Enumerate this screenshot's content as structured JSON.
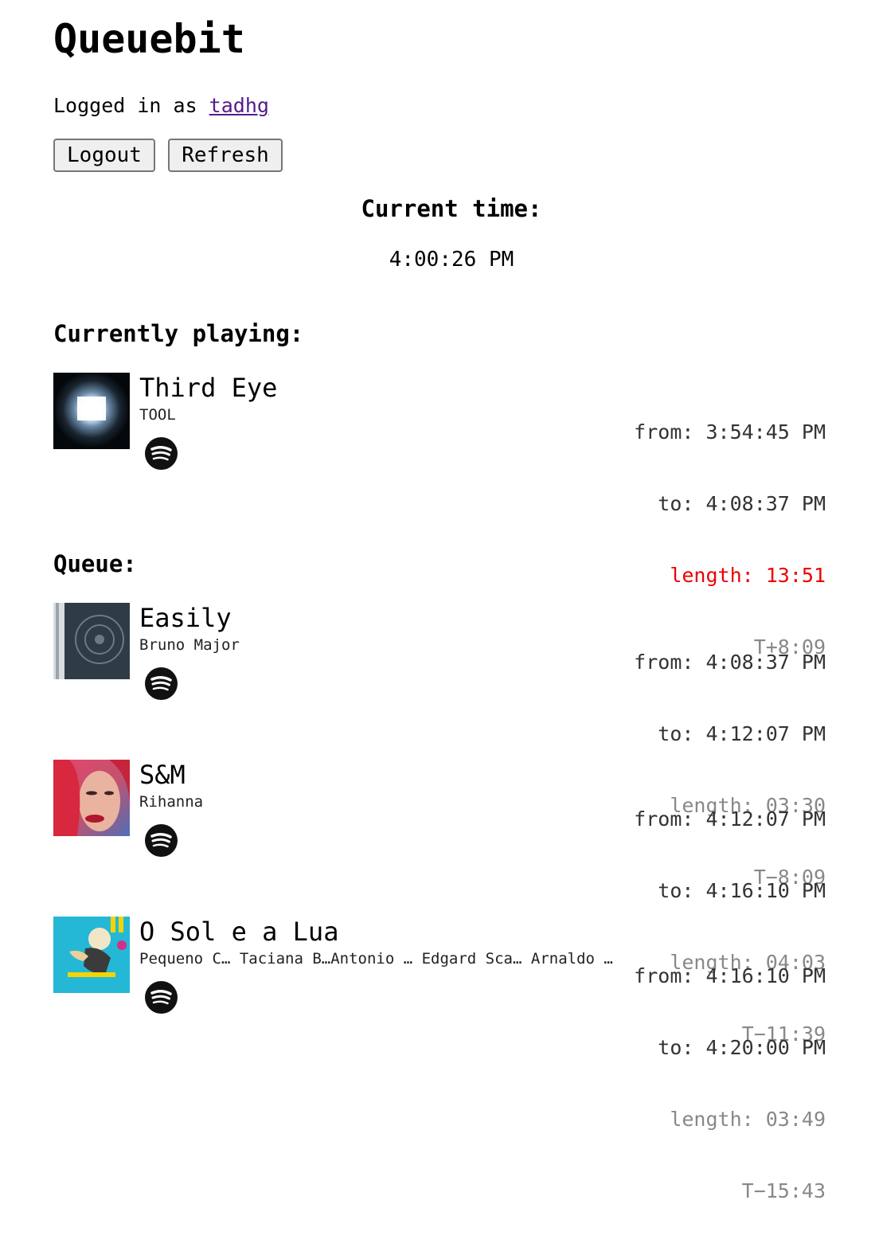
{
  "app": {
    "title": "Queuebit"
  },
  "login": {
    "prefix": "Logged in as ",
    "username": "tadhg"
  },
  "buttons": {
    "logout": "Logout",
    "refresh": "Refresh"
  },
  "clock": {
    "label": "Current time:",
    "value": "4:00:26 PM"
  },
  "sections": {
    "current": "Currently playing:",
    "queue": "Queue:"
  },
  "current": {
    "title": "Third Eye",
    "artist": "TOOL",
    "from": "from: 3:54:45 PM",
    "to": "to: 4:08:37 PM",
    "length": "length: 13:51",
    "relative": "T+8:09"
  },
  "queue": [
    {
      "title": "Easily",
      "artist": "Bruno Major",
      "from": "from: 4:08:37 PM",
      "to": "to: 4:12:07 PM",
      "length": "length: 03:30",
      "relative": "T−8:09"
    },
    {
      "title": "S&M",
      "artist": "Rihanna",
      "from": "from: 4:12:07 PM",
      "to": "to: 4:16:10 PM",
      "length": "length: 04:03",
      "relative": "T−11:39"
    },
    {
      "title": "O Sol e a Lua",
      "artist": "Pequeno C… Taciana B…Antonio … Edgard Sca… Arnaldo …",
      "from": "from: 4:16:10 PM",
      "to": "to: 4:20:00 PM",
      "length": "length: 03:49",
      "relative": "T−15:43"
    }
  ],
  "icons": {
    "service": "spotify-icon"
  },
  "colors": {
    "link": "#551a8b",
    "over_length": "#ee0000",
    "muted": "#888888"
  }
}
